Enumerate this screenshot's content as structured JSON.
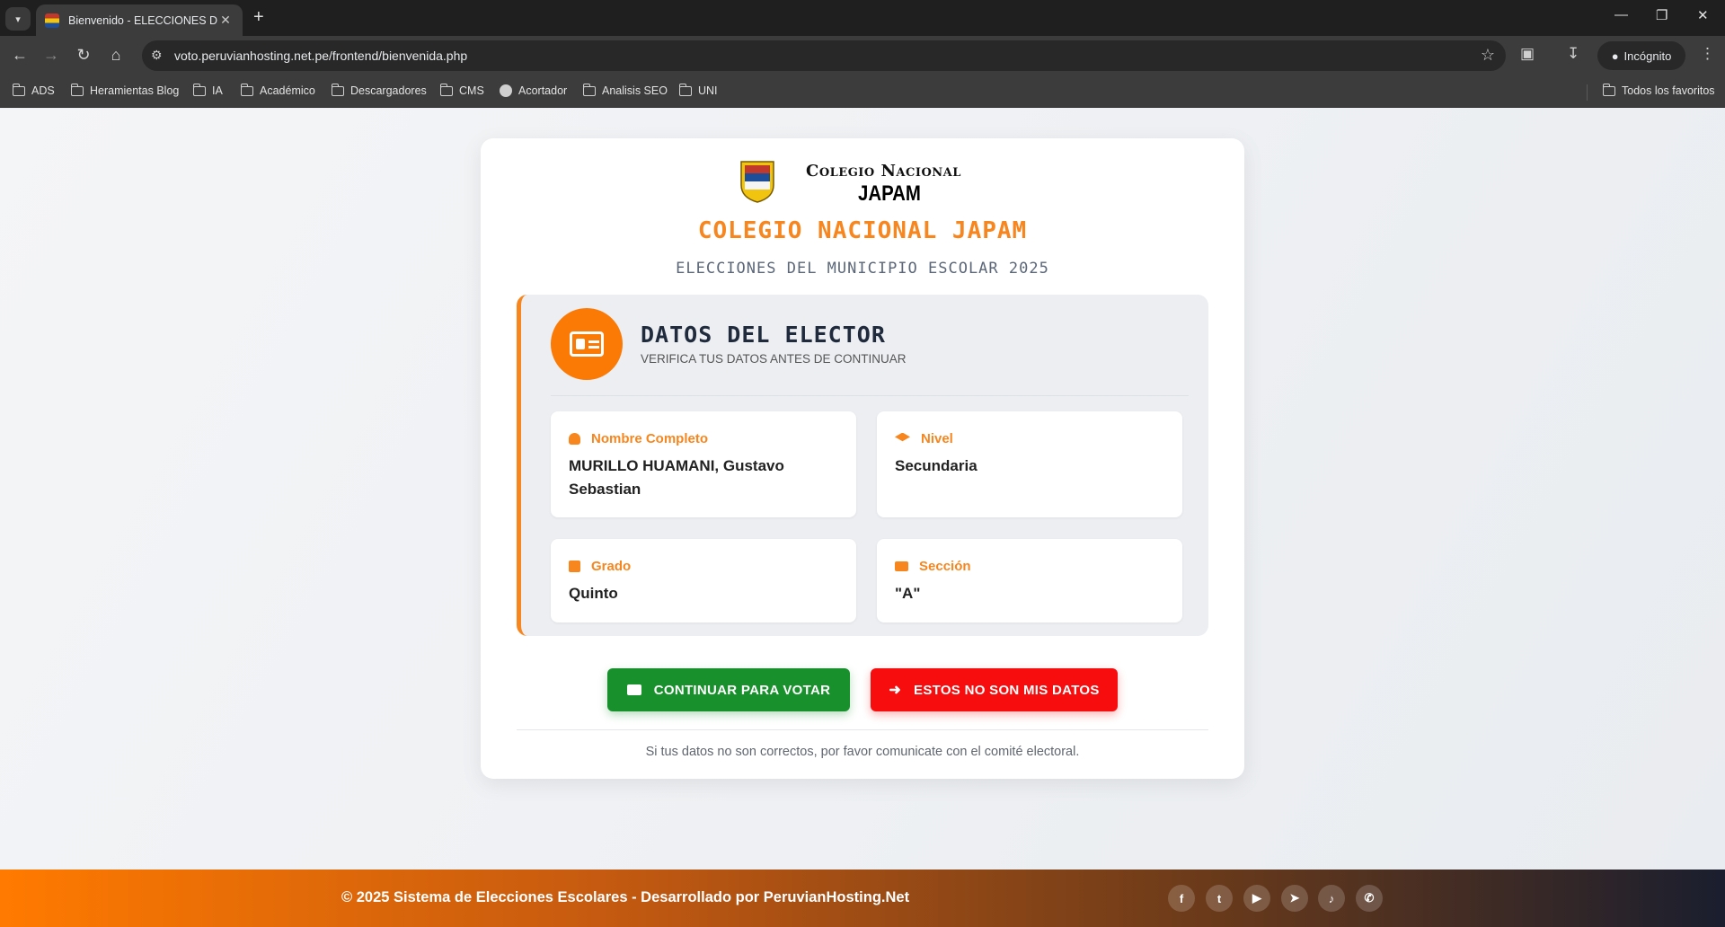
{
  "browser": {
    "tab_title": "Bienvenido - ELECCIONES DEL I",
    "url": "voto.peruvianhosting.net.pe/frontend/bienvenida.php",
    "incognito_label": "Incógnito",
    "bookmarks": [
      {
        "label": "ADS",
        "icon": "folder-icon"
      },
      {
        "label": "Heramientas Blog",
        "icon": "folder-icon"
      },
      {
        "label": "IA",
        "icon": "folder-icon"
      },
      {
        "label": "Académico",
        "icon": "folder-icon"
      },
      {
        "label": "Descargadores",
        "icon": "folder-icon"
      },
      {
        "label": "CMS",
        "icon": "folder-icon"
      },
      {
        "label": "Acortador",
        "icon": "globe-icon"
      },
      {
        "label": "Analisis SEO",
        "icon": "folder-icon"
      },
      {
        "label": "UNI",
        "icon": "folder-icon"
      }
    ],
    "all_bookmarks_label": "Todos los favoritos"
  },
  "header": {
    "school_line1": "Colegio Nacional",
    "school_line2": "JAPAM",
    "title": "COLEGIO NACIONAL JAPAM",
    "subtitle": "ELECCIONES DEL MUNICIPIO ESCOLAR 2025"
  },
  "elector": {
    "title": "DATOS DEL ELECTOR",
    "subtitle": "VERIFICA TUS DATOS ANTES DE CONTINUAR",
    "fields": [
      {
        "label": "Nombre Completo",
        "value": "MURILLO HUAMANI, Gustavo Sebastian"
      },
      {
        "label": "Nivel",
        "value": "Secundaria"
      },
      {
        "label": "Grado",
        "value": "Quinto"
      },
      {
        "label": "Sección",
        "value": "\"A\""
      }
    ]
  },
  "actions": {
    "continue_label": "CONTINUAR PARA VOTAR",
    "not_mine_label": "ESTOS NO SON MIS DATOS"
  },
  "note": "Si tus datos no son correctos, por favor comunicate con el comité electoral.",
  "footer": {
    "text": "© 2025 Sistema de Elecciones Escolares - Desarrollado por PeruvianHosting.Net",
    "social": [
      "facebook-icon",
      "twitter-icon",
      "youtube-icon",
      "telegram-icon",
      "tiktok-icon",
      "whatsapp-icon"
    ]
  },
  "colors": {
    "accent": "#f7861e",
    "continue": "#18912d",
    "not_mine": "#f70d0d"
  }
}
